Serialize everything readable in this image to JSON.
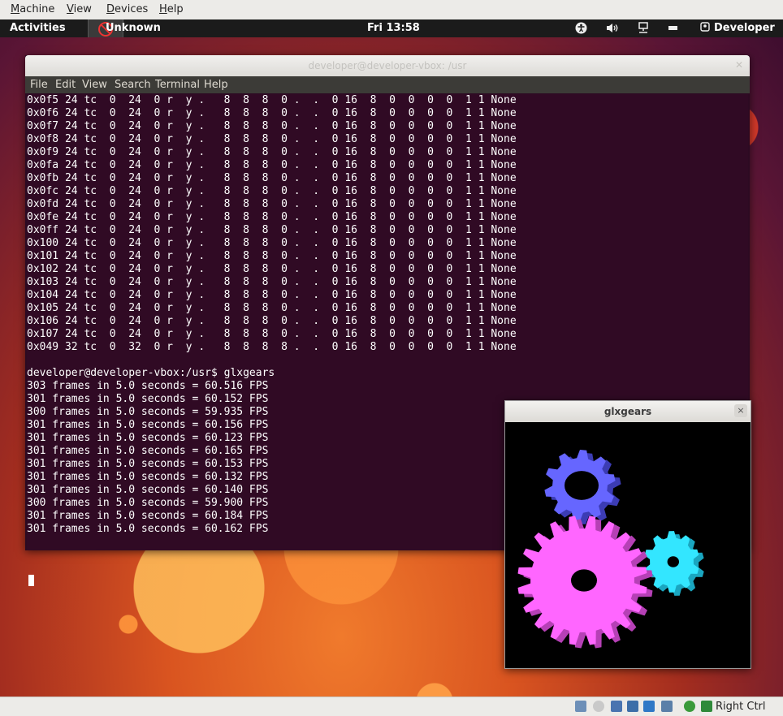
{
  "host_menu": {
    "items": [
      {
        "label": "Machine",
        "key": "M",
        "rest": "achine"
      },
      {
        "label": "View",
        "key": "V",
        "rest": "iew"
      },
      {
        "label": "Devices",
        "key": "D",
        "rest": "evices"
      },
      {
        "label": "Help",
        "key": "H",
        "rest": "elp"
      }
    ]
  },
  "top_panel": {
    "activities": "Activities",
    "app_name": "Unknown",
    "clock": "Fri 13:58",
    "user": "Developer"
  },
  "terminal": {
    "title": "developer@developer-vbox: /usr",
    "menu": [
      "File",
      "Edit",
      "View",
      "Search",
      "Terminal",
      "Help"
    ],
    "lines": [
      "0x0f5 24 tc  0  24  0 r  y .   8  8  8  0 .  .  0 16  8  0  0  0  0  1 1 None",
      "0x0f6 24 tc  0  24  0 r  y .   8  8  8  0 .  .  0 16  8  0  0  0  0  1 1 None",
      "0x0f7 24 tc  0  24  0 r  y .   8  8  8  0 .  .  0 16  8  0  0  0  0  1 1 None",
      "0x0f8 24 tc  0  24  0 r  y .   8  8  8  0 .  .  0 16  8  0  0  0  0  1 1 None",
      "0x0f9 24 tc  0  24  0 r  y .   8  8  8  0 .  .  0 16  8  0  0  0  0  1 1 None",
      "0x0fa 24 tc  0  24  0 r  y .   8  8  8  0 .  .  0 16  8  0  0  0  0  1 1 None",
      "0x0fb 24 tc  0  24  0 r  y .   8  8  8  0 .  .  0 16  8  0  0  0  0  1 1 None",
      "0x0fc 24 tc  0  24  0 r  y .   8  8  8  0 .  .  0 16  8  0  0  0  0  1 1 None",
      "0x0fd 24 tc  0  24  0 r  y .   8  8  8  0 .  .  0 16  8  0  0  0  0  1 1 None",
      "0x0fe 24 tc  0  24  0 r  y .   8  8  8  0 .  .  0 16  8  0  0  0  0  1 1 None",
      "0x0ff 24 tc  0  24  0 r  y .   8  8  8  0 .  .  0 16  8  0  0  0  0  1 1 None",
      "0x100 24 tc  0  24  0 r  y .   8  8  8  0 .  .  0 16  8  0  0  0  0  1 1 None",
      "0x101 24 tc  0  24  0 r  y .   8  8  8  0 .  .  0 16  8  0  0  0  0  1 1 None",
      "0x102 24 tc  0  24  0 r  y .   8  8  8  0 .  .  0 16  8  0  0  0  0  1 1 None",
      "0x103 24 tc  0  24  0 r  y .   8  8  8  0 .  .  0 16  8  0  0  0  0  1 1 None",
      "0x104 24 tc  0  24  0 r  y .   8  8  8  0 .  .  0 16  8  0  0  0  0  1 1 None",
      "0x105 24 tc  0  24  0 r  y .   8  8  8  0 .  .  0 16  8  0  0  0  0  1 1 None",
      "0x106 24 tc  0  24  0 r  y .   8  8  8  0 .  .  0 16  8  0  0  0  0  1 1 None",
      "0x107 24 tc  0  24  0 r  y .   8  8  8  0 .  .  0 16  8  0  0  0  0  1 1 None",
      "0x049 32 tc  0  32  0 r  y .   8  8  8  8 .  .  0 16  8  0  0  0  0  1 1 None",
      "",
      "developer@developer-vbox:/usr$ glxgears",
      "303 frames in 5.0 seconds = 60.516 FPS",
      "301 frames in 5.0 seconds = 60.152 FPS",
      "300 frames in 5.0 seconds = 59.935 FPS",
      "301 frames in 5.0 seconds = 60.156 FPS",
      "301 frames in 5.0 seconds = 60.123 FPS",
      "301 frames in 5.0 seconds = 60.165 FPS",
      "301 frames in 5.0 seconds = 60.153 FPS",
      "301 frames in 5.0 seconds = 60.132 FPS",
      "301 frames in 5.0 seconds = 60.140 FPS",
      "300 frames in 5.0 seconds = 59.900 FPS",
      "301 frames in 5.0 seconds = 60.184 FPS",
      "301 frames in 5.0 seconds = 60.162 FPS"
    ]
  },
  "glxgears": {
    "title": "glxgears",
    "close_glyph": "×",
    "gear_colors": {
      "large": "#ff66ff",
      "small": "#6666ff",
      "medium": "#33e6ff"
    }
  },
  "status_bar": {
    "host_key": "Right Ctrl",
    "icons": [
      "hard-disk-icon",
      "optical-drive-icon",
      "usb-icon",
      "network-icon",
      "shared-folders-icon",
      "display-icon",
      "mouse-integration-icon",
      "host-key-icon"
    ]
  },
  "colors": {
    "terminal_bg": "#300a24",
    "panel_bg": "#1b1b1b",
    "terminal_menu_bg": "#3c3b37"
  }
}
